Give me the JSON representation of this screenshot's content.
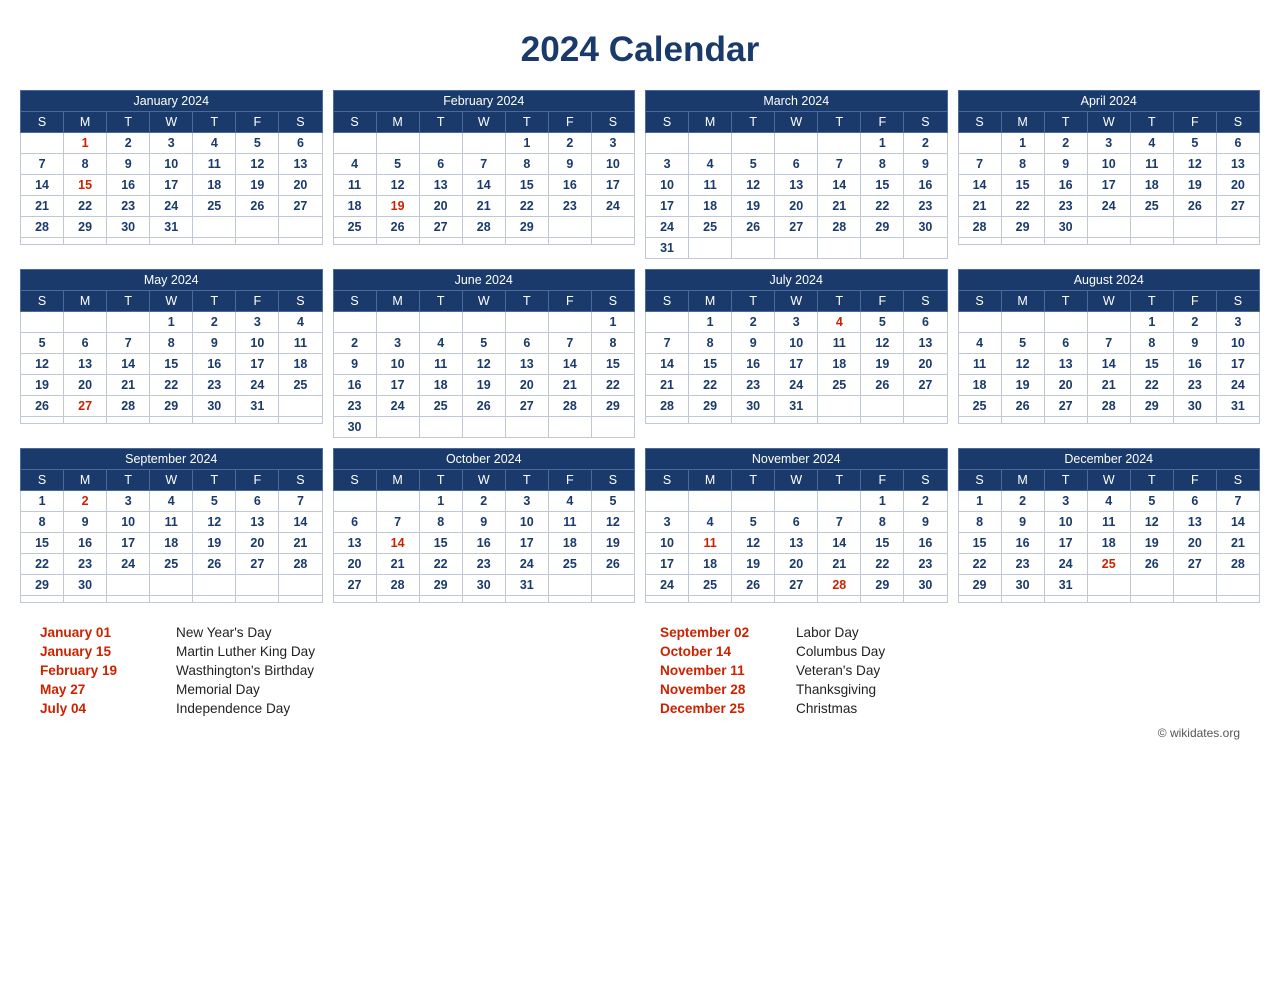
{
  "title": "2024 Calendar",
  "months": [
    {
      "name": "January 2024",
      "days": [
        [
          "",
          "1",
          "2",
          "3",
          "4",
          "5",
          "6"
        ],
        [
          "7",
          "8",
          "9",
          "10",
          "11",
          "12",
          "13"
        ],
        [
          "14",
          "15",
          "16",
          "17",
          "18",
          "19",
          "20"
        ],
        [
          "21",
          "22",
          "23",
          "24",
          "25",
          "26",
          "27"
        ],
        [
          "28",
          "29",
          "30",
          "31",
          "",
          "",
          ""
        ],
        [
          "",
          "",
          "",
          "",
          "",
          "",
          ""
        ]
      ],
      "holidays": [
        "1",
        "15"
      ]
    },
    {
      "name": "February 2024",
      "days": [
        [
          "",
          "",
          "",
          "",
          "1",
          "2",
          "3"
        ],
        [
          "4",
          "5",
          "6",
          "7",
          "8",
          "9",
          "10"
        ],
        [
          "11",
          "12",
          "13",
          "14",
          "15",
          "16",
          "17"
        ],
        [
          "18",
          "19",
          "20",
          "21",
          "22",
          "23",
          "24"
        ],
        [
          "25",
          "26",
          "27",
          "28",
          "29",
          "",
          ""
        ],
        [
          "",
          "",
          "",
          "",
          "",
          "",
          ""
        ]
      ],
      "holidays": [
        "19"
      ]
    },
    {
      "name": "March 2024",
      "days": [
        [
          "",
          "",
          "",
          "",
          "",
          "1",
          "2"
        ],
        [
          "3",
          "4",
          "5",
          "6",
          "7",
          "8",
          "9"
        ],
        [
          "10",
          "11",
          "12",
          "13",
          "14",
          "15",
          "16"
        ],
        [
          "17",
          "18",
          "19",
          "20",
          "21",
          "22",
          "23"
        ],
        [
          "24",
          "25",
          "26",
          "27",
          "28",
          "29",
          "30"
        ],
        [
          "31",
          "",
          "",
          "",
          "",
          "",
          ""
        ]
      ],
      "holidays": []
    },
    {
      "name": "April 2024",
      "days": [
        [
          "",
          "1",
          "2",
          "3",
          "4",
          "5",
          "6"
        ],
        [
          "7",
          "8",
          "9",
          "10",
          "11",
          "12",
          "13"
        ],
        [
          "14",
          "15",
          "16",
          "17",
          "18",
          "19",
          "20"
        ],
        [
          "21",
          "22",
          "23",
          "24",
          "25",
          "26",
          "27"
        ],
        [
          "28",
          "29",
          "30",
          "",
          "",
          "",
          ""
        ],
        [
          "",
          "",
          "",
          "",
          "",
          "",
          ""
        ]
      ],
      "holidays": []
    },
    {
      "name": "May 2024",
      "days": [
        [
          "",
          "",
          "",
          "1",
          "2",
          "3",
          "4"
        ],
        [
          "5",
          "6",
          "7",
          "8",
          "9",
          "10",
          "11"
        ],
        [
          "12",
          "13",
          "14",
          "15",
          "16",
          "17",
          "18"
        ],
        [
          "19",
          "20",
          "21",
          "22",
          "23",
          "24",
          "25"
        ],
        [
          "26",
          "27",
          "28",
          "29",
          "30",
          "31",
          ""
        ],
        [
          "",
          "",
          "",
          "",
          "",
          "",
          ""
        ]
      ],
      "holidays": [
        "27"
      ]
    },
    {
      "name": "June 2024",
      "days": [
        [
          "",
          "",
          "",
          "",
          "",
          "",
          "1"
        ],
        [
          "2",
          "3",
          "4",
          "5",
          "6",
          "7",
          "8"
        ],
        [
          "9",
          "10",
          "11",
          "12",
          "13",
          "14",
          "15"
        ],
        [
          "16",
          "17",
          "18",
          "19",
          "20",
          "21",
          "22"
        ],
        [
          "23",
          "24",
          "25",
          "26",
          "27",
          "28",
          "29"
        ],
        [
          "30",
          "",
          "",
          "",
          "",
          "",
          ""
        ]
      ],
      "holidays": []
    },
    {
      "name": "July 2024",
      "days": [
        [
          "",
          "1",
          "2",
          "3",
          "4",
          "5",
          "6"
        ],
        [
          "7",
          "8",
          "9",
          "10",
          "11",
          "12",
          "13"
        ],
        [
          "14",
          "15",
          "16",
          "17",
          "18",
          "19",
          "20"
        ],
        [
          "21",
          "22",
          "23",
          "24",
          "25",
          "26",
          "27"
        ],
        [
          "28",
          "29",
          "30",
          "31",
          "",
          "",
          ""
        ],
        [
          "",
          "",
          "",
          "",
          "",
          "",
          ""
        ]
      ],
      "holidays": [
        "4"
      ]
    },
    {
      "name": "August 2024",
      "days": [
        [
          "",
          "",
          "",
          "",
          "1",
          "2",
          "3"
        ],
        [
          "4",
          "5",
          "6",
          "7",
          "8",
          "9",
          "10"
        ],
        [
          "11",
          "12",
          "13",
          "14",
          "15",
          "16",
          "17"
        ],
        [
          "18",
          "19",
          "20",
          "21",
          "22",
          "23",
          "24"
        ],
        [
          "25",
          "26",
          "27",
          "28",
          "29",
          "30",
          "31"
        ],
        [
          "",
          "",
          "",
          "",
          "",
          "",
          ""
        ]
      ],
      "holidays": []
    },
    {
      "name": "September 2024",
      "days": [
        [
          "1",
          "2",
          "3",
          "4",
          "5",
          "6",
          "7"
        ],
        [
          "8",
          "9",
          "10",
          "11",
          "12",
          "13",
          "14"
        ],
        [
          "15",
          "16",
          "17",
          "18",
          "19",
          "20",
          "21"
        ],
        [
          "22",
          "23",
          "24",
          "25",
          "26",
          "27",
          "28"
        ],
        [
          "29",
          "30",
          "",
          "",
          "",
          "",
          ""
        ],
        [
          "",
          "",
          "",
          "",
          "",
          "",
          ""
        ]
      ],
      "holidays": [
        "2"
      ]
    },
    {
      "name": "October 2024",
      "days": [
        [
          "",
          "",
          "1",
          "2",
          "3",
          "4",
          "5"
        ],
        [
          "6",
          "7",
          "8",
          "9",
          "10",
          "11",
          "12"
        ],
        [
          "13",
          "14",
          "15",
          "16",
          "17",
          "18",
          "19"
        ],
        [
          "20",
          "21",
          "22",
          "23",
          "24",
          "25",
          "26"
        ],
        [
          "27",
          "28",
          "29",
          "30",
          "31",
          "",
          ""
        ],
        [
          "",
          "",
          "",
          "",
          "",
          "",
          ""
        ]
      ],
      "holidays": [
        "14"
      ]
    },
    {
      "name": "November 2024",
      "days": [
        [
          "",
          "",
          "",
          "",
          "",
          "1",
          "2"
        ],
        [
          "3",
          "4",
          "5",
          "6",
          "7",
          "8",
          "9"
        ],
        [
          "10",
          "11",
          "12",
          "13",
          "14",
          "15",
          "16"
        ],
        [
          "17",
          "18",
          "19",
          "20",
          "21",
          "22",
          "23"
        ],
        [
          "24",
          "25",
          "26",
          "27",
          "28",
          "29",
          "30"
        ],
        [
          "",
          "",
          "",
          "",
          "",
          "",
          ""
        ]
      ],
      "holidays": [
        "11",
        "28"
      ]
    },
    {
      "name": "December 2024",
      "days": [
        [
          "1",
          "2",
          "3",
          "4",
          "5",
          "6",
          "7"
        ],
        [
          "8",
          "9",
          "10",
          "11",
          "12",
          "13",
          "14"
        ],
        [
          "15",
          "16",
          "17",
          "18",
          "19",
          "20",
          "21"
        ],
        [
          "22",
          "23",
          "24",
          "25",
          "26",
          "27",
          "28"
        ],
        [
          "29",
          "30",
          "31",
          "",
          "",
          "",
          ""
        ],
        [
          "",
          "",
          "",
          "",
          "",
          "",
          ""
        ]
      ],
      "holidays": [
        "25"
      ]
    }
  ],
  "holidays_left": [
    {
      "date": "January 01",
      "name": "New Year's Day"
    },
    {
      "date": "January 15",
      "name": "Martin Luther King Day"
    },
    {
      "date": "February 19",
      "name": "Wasthington's Birthday"
    },
    {
      "date": "May 27",
      "name": "Memorial Day"
    },
    {
      "date": "July 04",
      "name": "Independence Day"
    }
  ],
  "holidays_right": [
    {
      "date": "September 02",
      "name": "Labor Day"
    },
    {
      "date": "October 14",
      "name": "Columbus Day"
    },
    {
      "date": "November 11",
      "name": "Veteran's Day"
    },
    {
      "date": "November 28",
      "name": "Thanksgiving"
    },
    {
      "date": "December 25",
      "name": "Christmas"
    }
  ],
  "copyright": "© wikidates.org",
  "day_headers": [
    "S",
    "M",
    "T",
    "W",
    "T",
    "F",
    "S"
  ]
}
